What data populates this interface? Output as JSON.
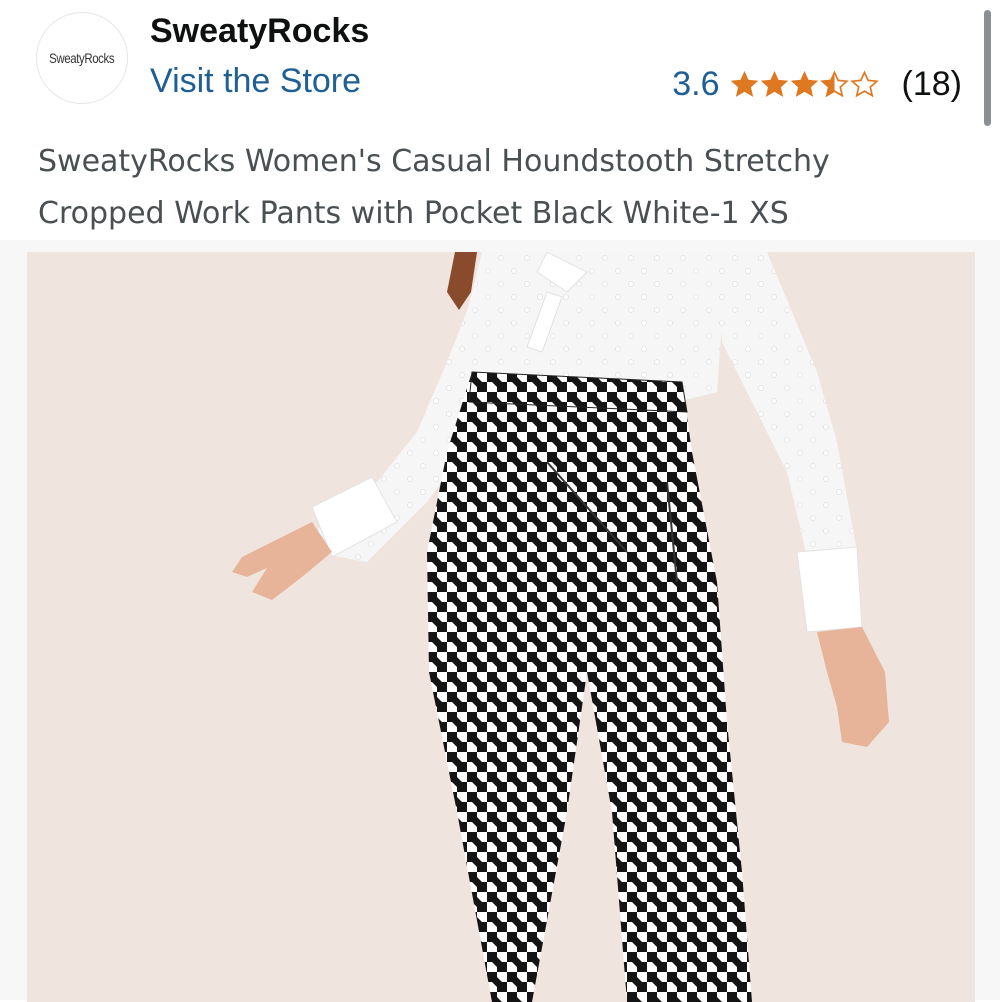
{
  "store": {
    "logo_text": "SweatyRocks",
    "brand_name": "SweatyRocks",
    "visit_label": "Visit the Store"
  },
  "rating": {
    "value": "3.6",
    "stars": 3.5,
    "review_count": "(18)",
    "star_color": "#de7921"
  },
  "product": {
    "title_line1": "SweatyRocks Women's Casual Houndstooth Stretchy",
    "title_line2": "Cropped Work Pants with Pocket Black White-1 XS"
  },
  "image": {
    "alt": "Model wearing black and white houndstooth cropped pants with a sheer white blouse",
    "background": "#efe5de"
  }
}
